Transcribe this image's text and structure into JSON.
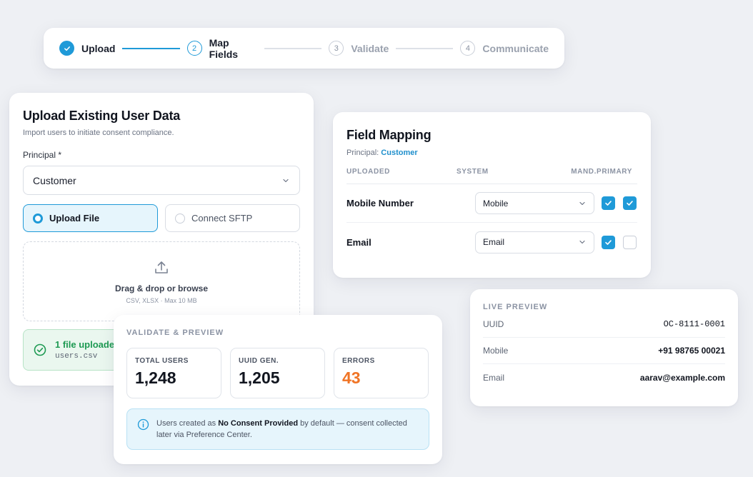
{
  "stepper": {
    "steps": [
      {
        "number": "1",
        "label": "Upload",
        "state": "done"
      },
      {
        "number": "2",
        "label": "Map Fields",
        "state": "active"
      },
      {
        "number": "3",
        "label": "Validate",
        "state": "todo"
      },
      {
        "number": "4",
        "label": "Communicate",
        "state": "todo"
      }
    ]
  },
  "upload": {
    "title": "Upload Existing User Data",
    "subtitle": "Import users to initiate consent compliance.",
    "principal_label": "Principal *",
    "principal_value": "Customer",
    "option_upload": "Upload File",
    "option_sftp": "Connect SFTP",
    "drop_title": "Drag & drop or browse",
    "drop_sub": "CSV, XLSX · Max 10 MB",
    "uploaded_title": "1 file uploaded",
    "uploaded_file": "users.csv"
  },
  "mapping": {
    "title": "Field Mapping",
    "principal_prefix": "Principal: ",
    "principal_value": "Customer",
    "headers": {
      "uploaded": "UPLOADED",
      "system": "SYSTEM",
      "mandatory": "MAND.",
      "primary": "PRIMARY"
    },
    "rows": [
      {
        "uploaded": "Mobile Number",
        "system": "Mobile",
        "mandatory": true,
        "primary": true
      },
      {
        "uploaded": "Email",
        "system": "Email",
        "mandatory": true,
        "primary": false
      }
    ]
  },
  "preview": {
    "label": "LIVE PREVIEW",
    "rows": [
      {
        "key": "UUID",
        "value": "OC-8111-0001"
      },
      {
        "key": "Mobile",
        "value": "+91 98765 00021"
      },
      {
        "key": "Email",
        "value": "aarav@example.com"
      }
    ]
  },
  "validate": {
    "label": "VALIDATE & PREVIEW",
    "stats": [
      {
        "label": "TOTAL USERS",
        "value": "1,248"
      },
      {
        "label": "UUID GEN.",
        "value": "1,205"
      },
      {
        "label": "ERRORS",
        "value": "43"
      }
    ],
    "info_prefix": "Users created as ",
    "info_bold": "No Consent Provided",
    "info_suffix": " by default — consent collected later via Preference Center."
  },
  "colors": {
    "accent": "#1f9ad8",
    "success": "#1e9a53",
    "error": "#f07425"
  },
  "icons": [
    "check-icon",
    "chevron-down-icon",
    "upload-icon",
    "check-circle-icon",
    "info-icon"
  ]
}
